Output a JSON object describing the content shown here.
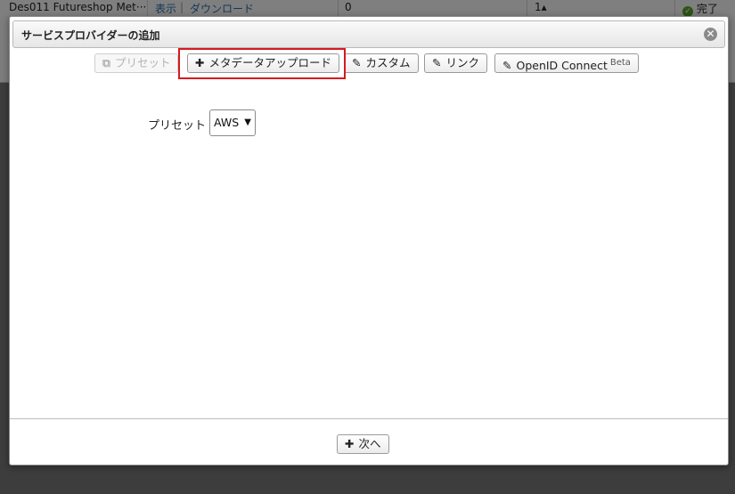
{
  "background": {
    "row_name": "Des011 Futureshop Met···",
    "link_view": "表示",
    "link_sep": "|",
    "link_download": "ダウンロード",
    "count": "0",
    "number": "1▴",
    "status": "完了"
  },
  "dialog": {
    "title": "サービスプロバイダーの追加",
    "close_glyph": "✕"
  },
  "toolbar": {
    "preset_label": "プリセット",
    "metadata_upload_label": "メタデータアップロード",
    "custom_label": "カスタム",
    "link_label": "リンク",
    "openid_label": "OpenID Connect",
    "openid_badge": "Beta"
  },
  "form": {
    "preset_label": "プリセット",
    "preset_value": "AWS"
  },
  "footer": {
    "next_label": "次へ"
  },
  "colors": {
    "highlight": "#d71920",
    "link": "#2a6fb0",
    "status_ok": "#5aa832"
  }
}
